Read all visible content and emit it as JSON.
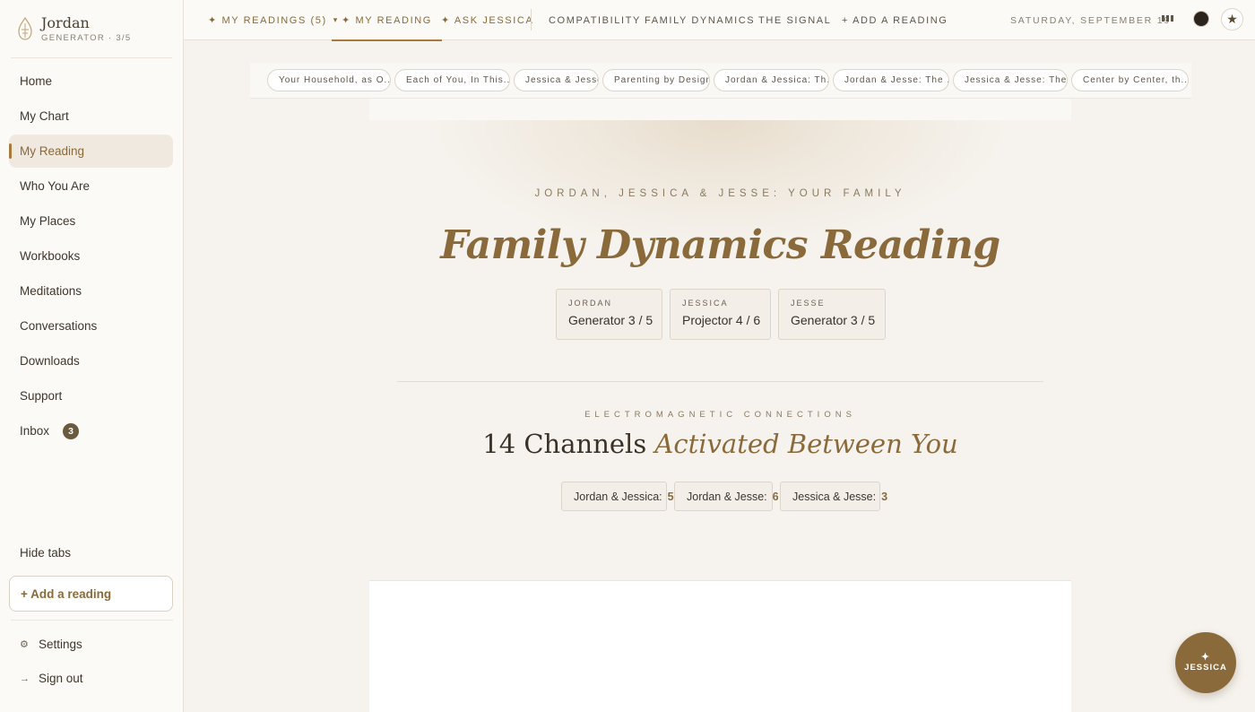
{
  "brand": {
    "name": "Jordan",
    "subtitle": "GENERATOR · 3/5"
  },
  "sidebar": {
    "items": [
      {
        "label": "Home"
      },
      {
        "label": "My Chart"
      },
      {
        "label": "My Reading"
      },
      {
        "label": "Who You Are"
      },
      {
        "label": "My Places"
      },
      {
        "label": "Workbooks"
      },
      {
        "label": "Meditations"
      },
      {
        "label": "Conversations"
      },
      {
        "label": "Downloads"
      },
      {
        "label": "Support"
      },
      {
        "label": "Inbox",
        "badge": "3"
      }
    ],
    "hide_tabs": "Hide tabs",
    "add_reading": "+ Add a reading",
    "settings": "Settings",
    "sign_out": "Sign out"
  },
  "topnav": {
    "my_readings": "✦ MY READINGS (5)",
    "my_readings_caret": "▾",
    "my_reading": "✦ MY READING",
    "ask_jessica": "✦ ASK JESSICA",
    "compatibility": "COMPATIBILITY",
    "family_dynamics": "FAMILY DYNAMICS",
    "the_signal": "THE SIGNAL",
    "add_reading": "+ ADD A READING",
    "date": "SATURDAY, SEPTEMBER 19"
  },
  "tabs": [
    "Your Household, as O...",
    "Each of You, In This...",
    "Jessica & Jesse",
    "Parenting by Design",
    "Jordan & Jessica: Th...",
    "Jordan & Jesse: The ...",
    "Jessica & Jesse: The...",
    "Center by Center, th..."
  ],
  "reading": {
    "kicker": "JORDAN, JESSICA & JESSE: YOUR FAMILY",
    "title": "Family Dynamics Reading",
    "people": [
      {
        "name": "JORDAN",
        "type": "Generator 3 / 5"
      },
      {
        "name": "JESSICA",
        "type": "Projector 4 / 6"
      },
      {
        "name": "JESSE",
        "type": "Generator 3 / 5"
      }
    ],
    "connections_kicker": "ELECTROMAGNETIC CONNECTIONS",
    "channels_count": "14 Channels",
    "channels_rest": "Activated Between You",
    "pairs": [
      {
        "label": "Jordan & Jessica:",
        "value": "5"
      },
      {
        "label": "Jordan & Jesse:",
        "value": "6"
      },
      {
        "label": "Jessica & Jesse:",
        "value": "3"
      }
    ]
  },
  "fab": {
    "spark": "✦",
    "label": "JESSICA"
  },
  "colors": {
    "accent": "#8a6a3a",
    "background": "#f6f3ee"
  }
}
